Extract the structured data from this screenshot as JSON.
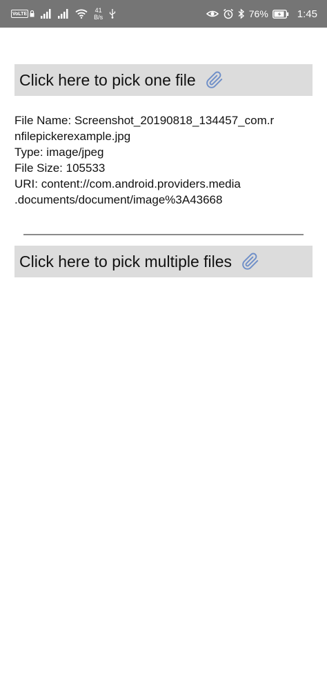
{
  "status_bar": {
    "volte": "VoLTE",
    "net_speed_value": "41",
    "net_speed_unit": "B/s",
    "battery": "76%",
    "time": "1:45"
  },
  "pick_one": {
    "label": "Click here to pick one file"
  },
  "file_info": {
    "name_line1": "File Name: Screenshot_20190818_134457_com.r",
    "name_line2": "nfilepickerexample.jpg",
    "type": "Type: image/jpeg",
    "size": "File Size: 105533",
    "uri_line1": "URI: content://com.android.providers.media",
    "uri_line2": ".documents/document/image%3A43668"
  },
  "pick_multiple": {
    "label": "Click here to pick multiple files"
  },
  "colors": {
    "status_bar_bg": "#757575",
    "button_bg": "#dcdcdc",
    "clip_icon": "#6f8fc8",
    "divider": "#8a8a8a"
  }
}
